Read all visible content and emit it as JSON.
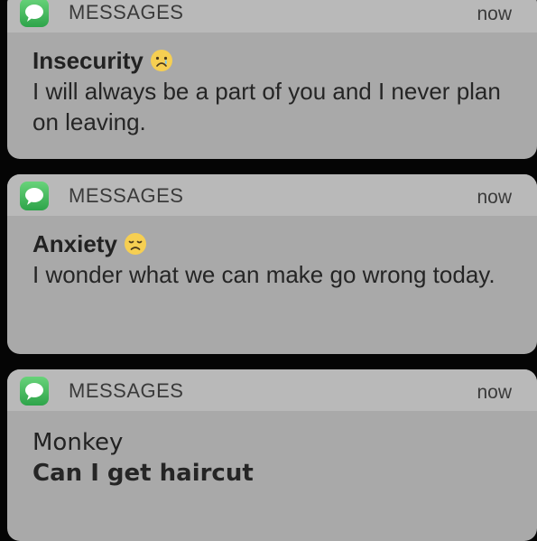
{
  "notifications": [
    {
      "app_icon": "messages-app-icon",
      "app_name": "MESSAGES",
      "time": "now",
      "title": "Insecurity",
      "title_emoji": "crying-face-icon",
      "message": "I will always be a part of you and I never plan on leaving."
    },
    {
      "app_icon": "messages-app-icon",
      "app_name": "MESSAGES",
      "time": "now",
      "title": "Anxiety",
      "title_emoji": "disappointed-face-icon",
      "message": "I wonder what we can make go wrong today."
    },
    {
      "app_icon": "messages-app-icon",
      "app_name": "MESSAGES",
      "time": "now",
      "title": "Monkey",
      "message": "Can I get haircut"
    }
  ],
  "colors": {
    "background": "#050505",
    "card_body": "#a9a9a9",
    "card_header": "#b9b9b9",
    "messages_green": "#38b654",
    "emoji_yellow": "#f6cf52"
  }
}
